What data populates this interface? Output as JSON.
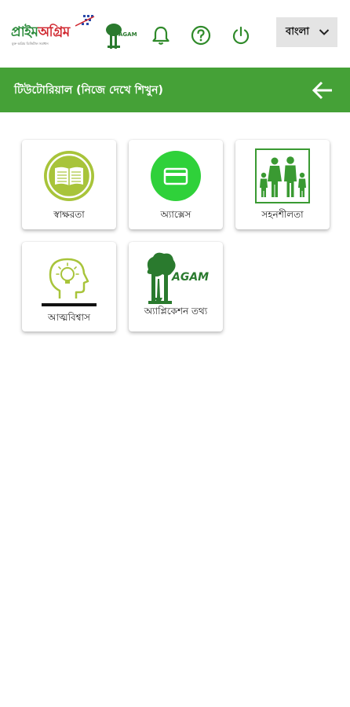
{
  "topbar": {
    "logo_text_1": "প্রাইম",
    "logo_text_2": "অগ্রিম",
    "logo_subtext": "মুক্ত অগ্রিম ডিজিটাল সমাধান",
    "agam_small_text": "AGAM",
    "language_value": "বাংলা"
  },
  "header": {
    "title": "টিউটোরিয়াল (নিজে দেখে শিখুন)"
  },
  "cards": [
    {
      "label": "স্বাক্ষরতা",
      "icon": "book-icon"
    },
    {
      "label": "অ্যাক্সেস",
      "icon": "card-icon"
    },
    {
      "label": "সহনশীলতা",
      "icon": "family-icon"
    },
    {
      "label": "আত্মবিশ্বাস",
      "icon": "head-bulb-icon"
    },
    {
      "label": "অ্যাপ্লিকেশন তথ্য",
      "icon": "agam-logo-icon",
      "logo_text": "AGAM"
    }
  ],
  "colors": {
    "header_green": "#45a137",
    "olive": "#a8c43a",
    "bright_green": "#2fd13a",
    "family_green": "#3a9a32"
  }
}
